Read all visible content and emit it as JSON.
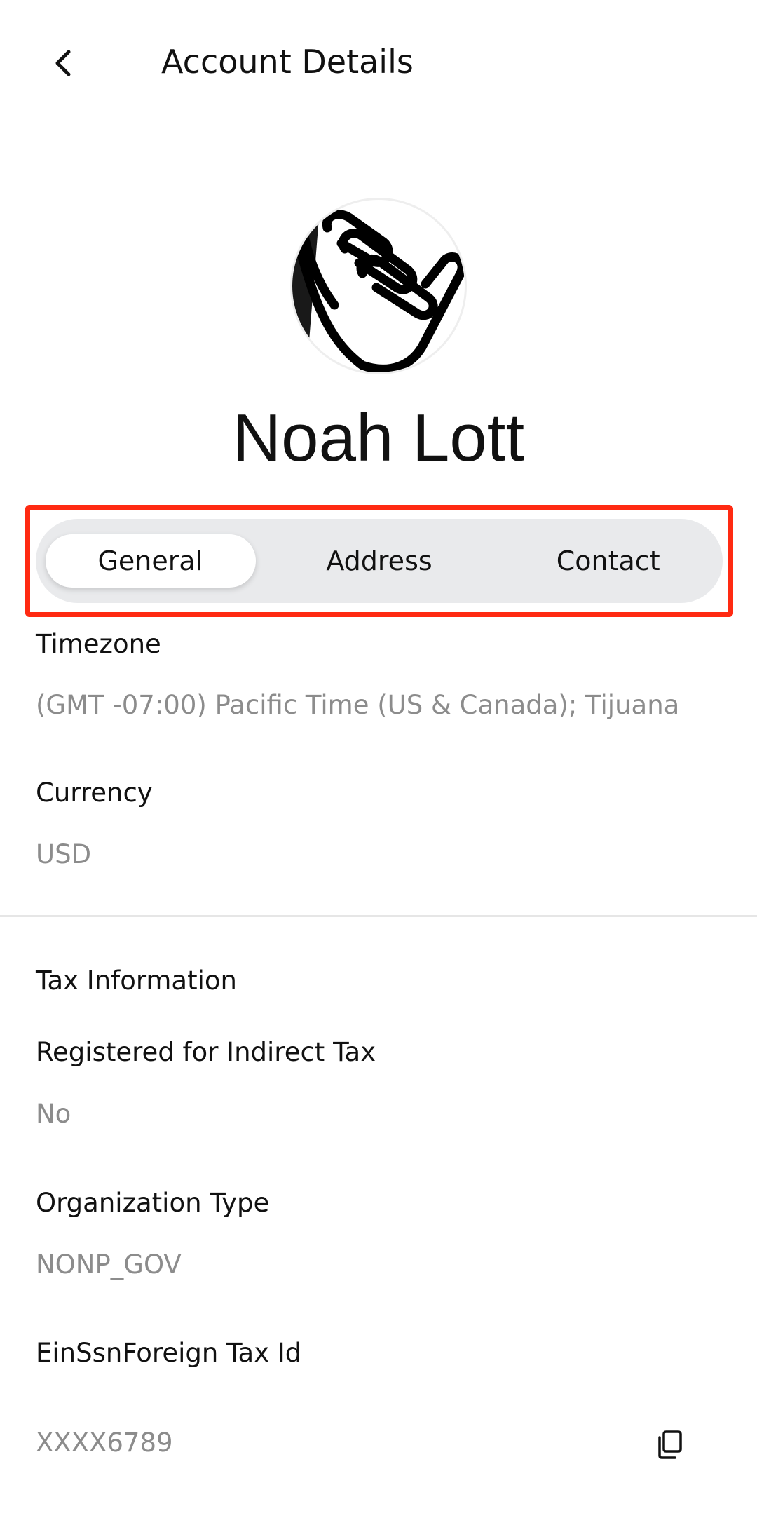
{
  "header": {
    "title": "Account Details",
    "back_icon": "chevron-left-icon"
  },
  "profile": {
    "name": "Noah Lott",
    "avatar_icon": "shaka-hand-icon"
  },
  "tabs": [
    {
      "label": "General",
      "active": true
    },
    {
      "label": "Address",
      "active": false
    },
    {
      "label": "Contact",
      "active": false
    }
  ],
  "general": {
    "timezone_label": "Timezone",
    "timezone_value": "(GMT -07:00) Pacific Time (US & Canada); Tijuana",
    "currency_label": "Currency",
    "currency_value": "USD"
  },
  "tax": {
    "section_title": "Tax Information",
    "indirect_label": "Registered for Indirect Tax",
    "indirect_value": "No",
    "org_type_label": "Organization Type",
    "org_type_value": "NONP_GOV",
    "tax_id_label": "EinSsnForeign Tax Id",
    "tax_id_value": "XXXX6789",
    "copy_icon": "copy-icon"
  },
  "colors": {
    "highlight": "#ff2a12",
    "segment_bg": "#e9eaec",
    "value_text": "#8c8c8c"
  }
}
